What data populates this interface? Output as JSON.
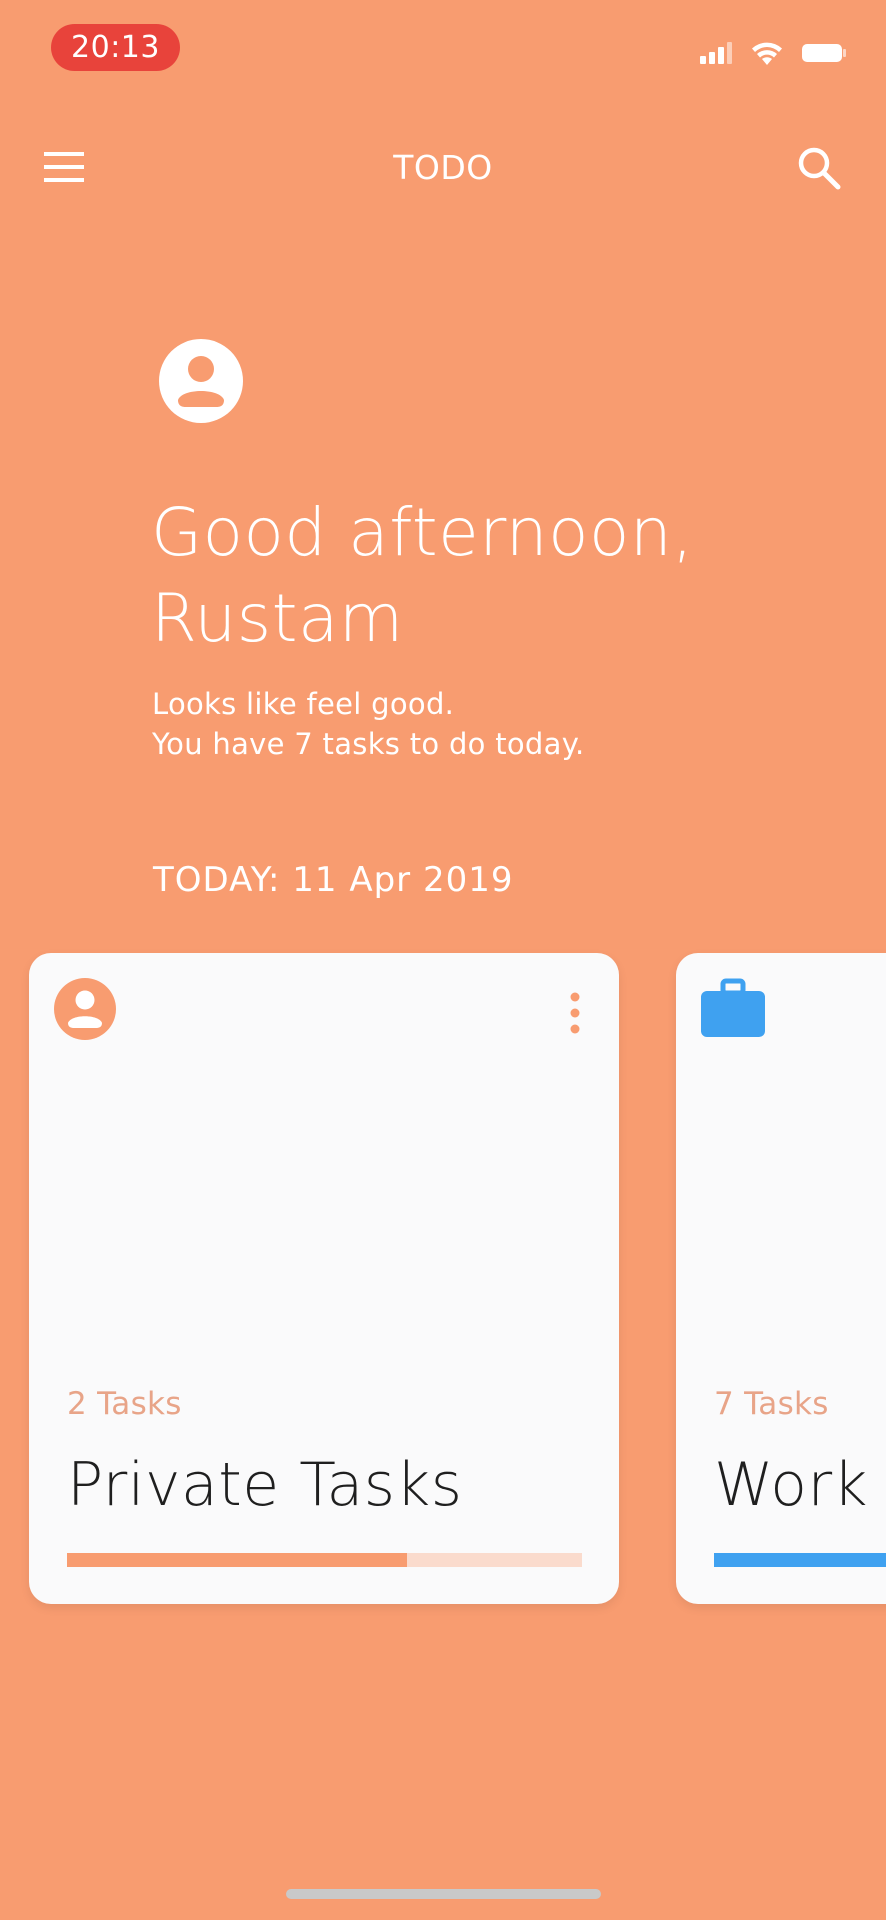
{
  "colors": {
    "background": "#F89C70",
    "time_pill": "#E8433B",
    "card_bg": "#FAFAFB",
    "private_accent": "#F89C70",
    "private_track": "#FADBCD",
    "private_count": "#E8A488",
    "work_accent": "#3FA1F0",
    "work_count": "#E8A488"
  },
  "status_bar": {
    "time": "20:13",
    "icons": [
      "signal-icon",
      "wifi-icon",
      "battery-icon"
    ]
  },
  "app_bar": {
    "menu_icon": "menu-icon",
    "title": "TODO",
    "search_icon": "search-icon"
  },
  "header": {
    "avatar_icon": "account-circle-icon",
    "greeting_line1": "Good afternoon,",
    "greeting_line2": "Rustam",
    "subtitle_line1": "Looks like feel good.",
    "subtitle_line2": "You have 7 tasks to do today.",
    "today_label": "TODAY: 11 Apr 2019"
  },
  "cards": [
    {
      "icon": "account-circle-icon",
      "count_label": "2 Tasks",
      "name": "Private Tasks",
      "progress": 0.66,
      "more_icon": "more-vert-icon"
    },
    {
      "icon": "briefcase-icon",
      "count_label": "7 Tasks",
      "name": "Work",
      "progress": 1.0
    }
  ]
}
